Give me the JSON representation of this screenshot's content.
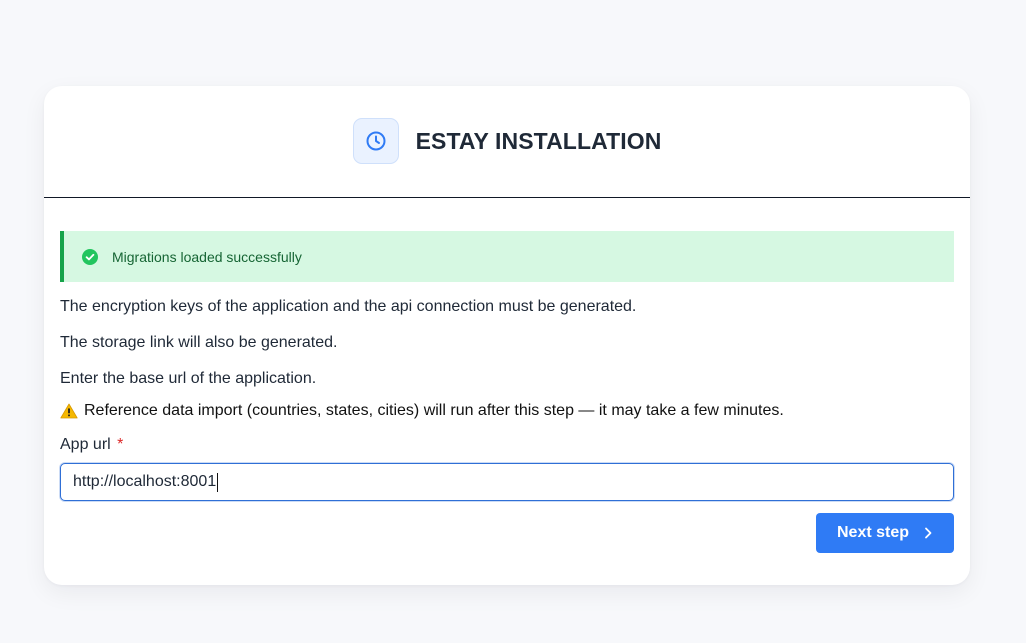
{
  "header": {
    "title": "ESTAY INSTALLATION",
    "logo_icon": "clock-icon"
  },
  "alert": {
    "icon": "check-circle-icon",
    "text": "Migrations loaded successfully",
    "color": "#16a34a"
  },
  "content": {
    "line1": "The encryption keys of the application and the api connection must be generated.",
    "line2": "The storage link will also be generated.",
    "line3": "Enter the base url of the application.",
    "warning_icon": "warning-icon",
    "warning": "Reference data import (countries, states, cities) will run after this step — it may take a few minutes."
  },
  "form": {
    "app_url_label": "App url",
    "required_mark": "*",
    "app_url_value": "http://localhost:8001"
  },
  "actions": {
    "next_label": "Next step",
    "next_icon": "chevron-right-icon"
  },
  "colors": {
    "accent": "#2f7bf5",
    "success_bg": "#d6f8e2",
    "page_bg": "#f7f8fb"
  }
}
